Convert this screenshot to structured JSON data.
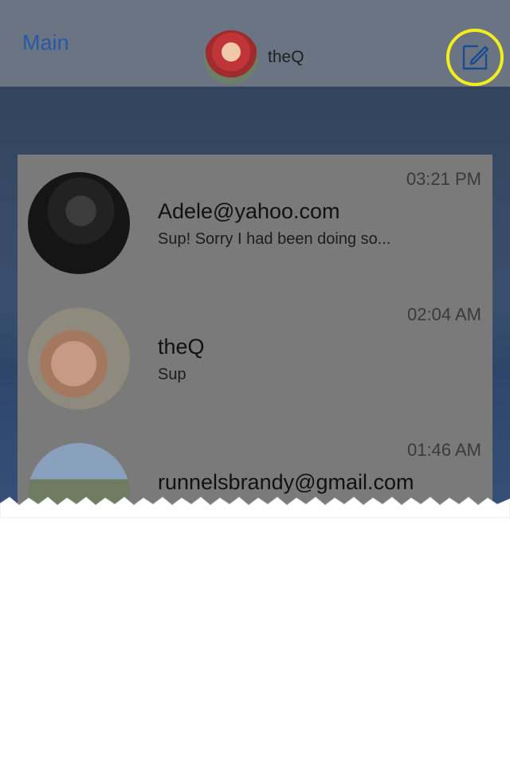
{
  "header": {
    "back_label": "Main",
    "title": "theQ",
    "avatar_icon": "profile-photo-icon",
    "compose_icon": "compose-icon",
    "highlight_color": "#f2ee1c"
  },
  "conversations": [
    {
      "name": "Adele@yahoo.com",
      "preview": "Sup! Sorry I had been doing so...",
      "time": "03:21 PM"
    },
    {
      "name": "theQ",
      "preview": "Sup",
      "time": "02:04 AM"
    },
    {
      "name": "runnelsbrandy@gmail.com",
      "preview": "",
      "time": "01:46 AM"
    }
  ]
}
